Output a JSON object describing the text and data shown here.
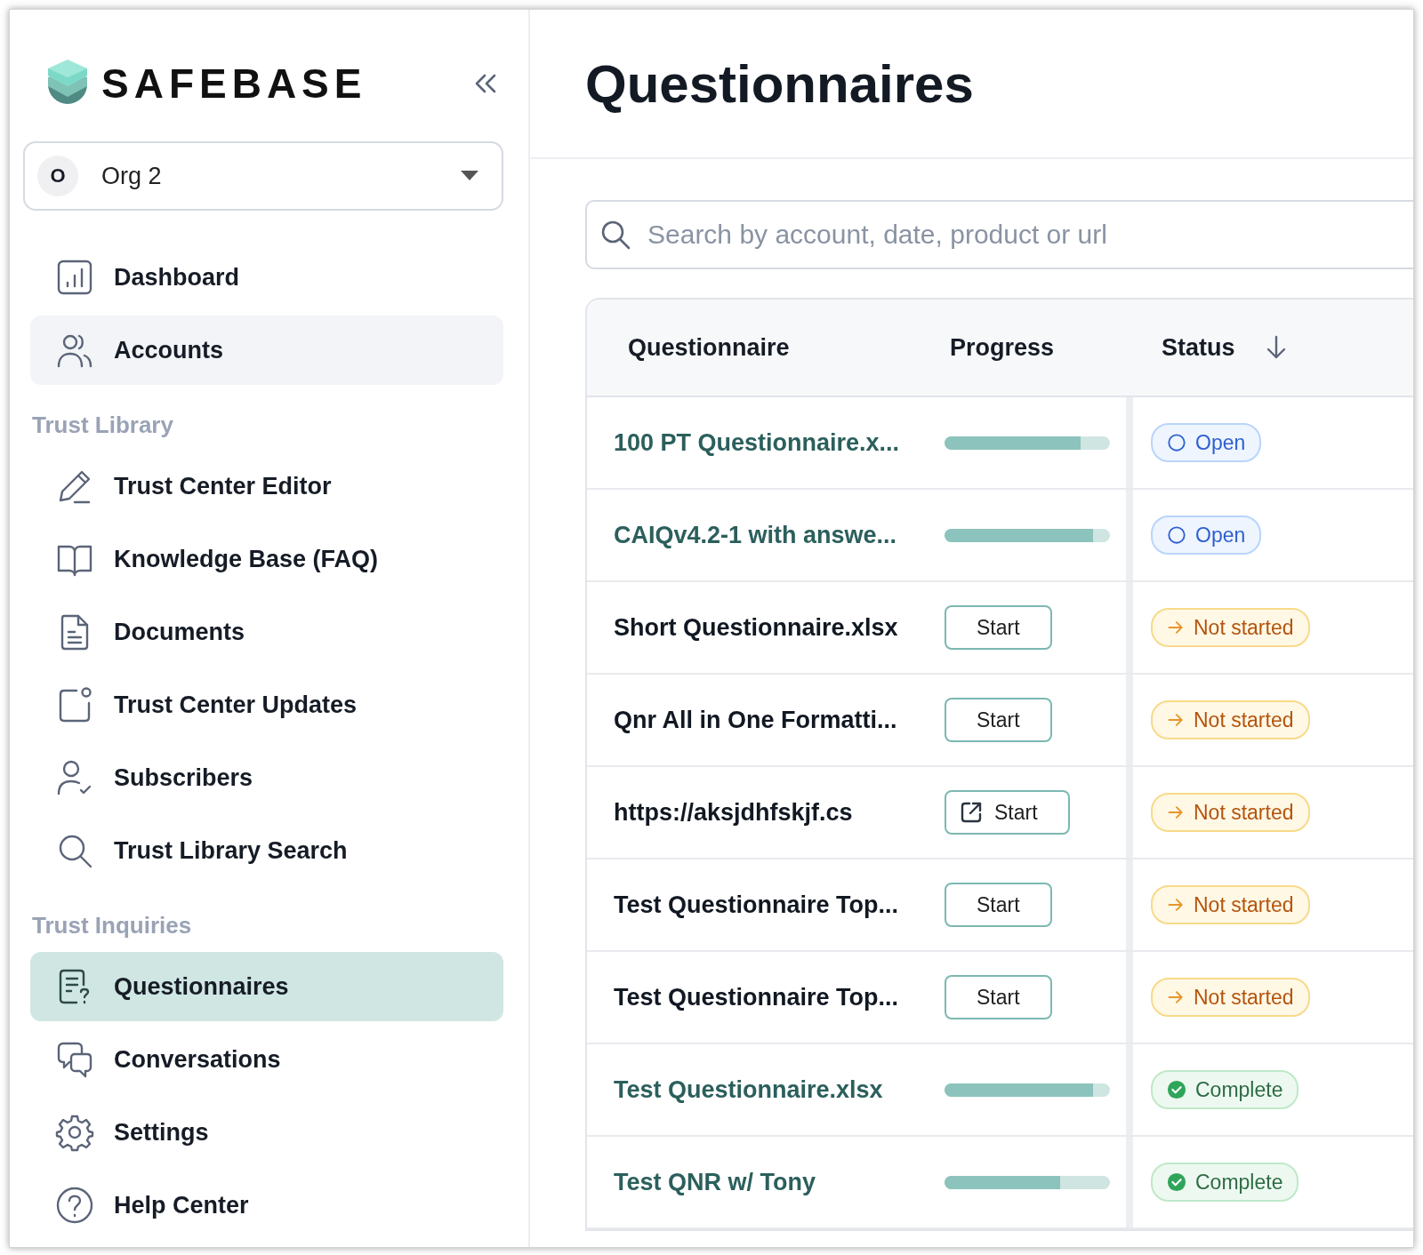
{
  "sidebar": {
    "brand": "SAFEBASE",
    "org": {
      "initial": "O",
      "name": "Org 2"
    },
    "sections": [
      {
        "items": [
          {
            "label": "Dashboard",
            "selected": false,
            "hovered": false
          },
          {
            "label": "Accounts",
            "selected": false,
            "hovered": true
          }
        ]
      },
      {
        "heading": "Trust Library",
        "items": [
          {
            "label": "Trust Center Editor",
            "selected": false,
            "hovered": false
          },
          {
            "label": "Knowledge Base (FAQ)",
            "selected": false,
            "hovered": false
          },
          {
            "label": "Documents",
            "selected": false,
            "hovered": false
          },
          {
            "label": "Trust Center Updates",
            "selected": false,
            "hovered": false
          },
          {
            "label": "Subscribers",
            "selected": false,
            "hovered": false
          },
          {
            "label": "Trust Library Search",
            "selected": false,
            "hovered": false
          }
        ]
      },
      {
        "heading": "Trust Inquiries",
        "items": [
          {
            "label": "Questionnaires",
            "selected": true,
            "hovered": false
          },
          {
            "label": "Conversations",
            "selected": false,
            "hovered": false
          },
          {
            "label": "Settings",
            "selected": false,
            "hovered": false
          },
          {
            "label": "Help Center",
            "selected": false,
            "hovered": false
          }
        ]
      }
    ]
  },
  "page": {
    "title": "Questionnaires",
    "search": {
      "placeholder": "Search by account, date, product or url"
    }
  },
  "table": {
    "columns": [
      "Questionnaire",
      "Progress",
      "Status"
    ],
    "rows": [
      {
        "name": "100 PT Questionnaire.x...",
        "kind": "progress",
        "level": 0.82,
        "status": {
          "kind": "open",
          "label": "Open"
        }
      },
      {
        "name": "CAIQv4.2-1 with answe...",
        "kind": "progress",
        "level": 0.9,
        "status": {
          "kind": "open",
          "label": "Open"
        }
      },
      {
        "name": "Short Questionnaire.xlsx",
        "kind": "start",
        "button": "Start",
        "external": false,
        "status": {
          "kind": "not_started",
          "label": "Not started"
        }
      },
      {
        "name": "Qnr All in One Formatti...",
        "kind": "start",
        "button": "Start",
        "external": false,
        "status": {
          "kind": "not_started",
          "label": "Not started"
        }
      },
      {
        "name": "https://aksjdhfskjf.cs",
        "kind": "start",
        "button": "Start",
        "external": true,
        "status": {
          "kind": "not_started",
          "label": "Not started"
        }
      },
      {
        "name": "Test Questionnaire Top...",
        "kind": "start",
        "button": "Start",
        "external": false,
        "status": {
          "kind": "not_started",
          "label": "Not started"
        }
      },
      {
        "name": "Test Questionnaire Top...",
        "kind": "start",
        "button": "Start",
        "external": false,
        "status": {
          "kind": "not_started",
          "label": "Not started"
        }
      },
      {
        "name": "Test Questionnaire.xlsx",
        "kind": "progress",
        "level": 0.9,
        "status": {
          "kind": "complete",
          "label": "Complete"
        }
      },
      {
        "name": "Test QNR w/ Tony",
        "kind": "progress",
        "level": 0.7,
        "status": {
          "kind": "complete",
          "label": "Complete"
        }
      }
    ]
  }
}
